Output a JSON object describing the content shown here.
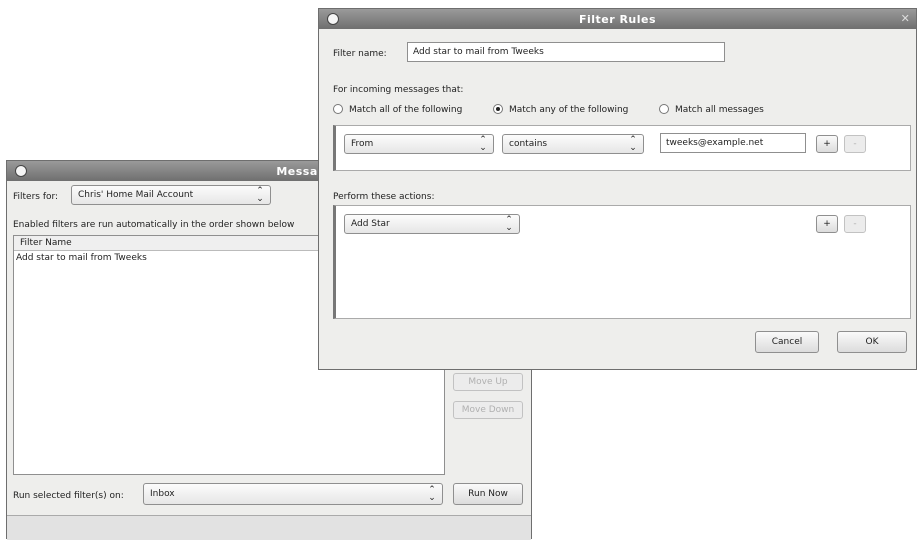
{
  "message_filters": {
    "title": "Message Filters",
    "filters_for_label": "Filters for:",
    "account": "Chris' Home Mail Account",
    "enabled_note": "Enabled filters are run automatically in the order shown below",
    "column_header": "Filter Name",
    "filters": [
      "Add star to mail from Tweeks"
    ],
    "move_up": "Move Up",
    "move_down": "Move Down",
    "run_selected_label": "Run selected filter(s) on:",
    "run_folder": "Inbox",
    "run_now": "Run Now"
  },
  "filter_rules": {
    "title": "Filter Rules",
    "filter_name_label": "Filter name:",
    "filter_name_value": "Add star to mail from Tweeks",
    "incoming_label": "For incoming messages that:",
    "match_options": [
      "Match all of the following",
      "Match any of the following",
      "Match all messages"
    ],
    "match_selected": 1,
    "condition": {
      "field": "From",
      "operator": "contains",
      "value": "tweeks@example.net"
    },
    "plus": "+",
    "minus": "-",
    "actions_label": "Perform these actions:",
    "action": "Add Star",
    "cancel": "Cancel",
    "ok": "OK"
  },
  "icons": {
    "arrows": "⌃⌄",
    "close": "✕"
  }
}
